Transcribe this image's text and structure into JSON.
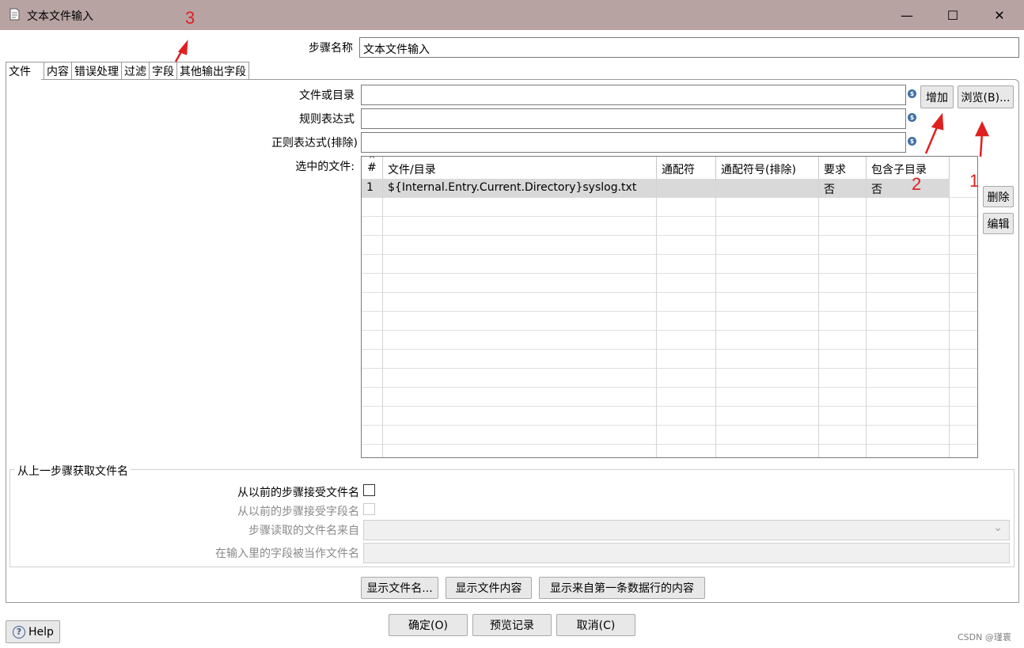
{
  "window": {
    "title": "文本文件输入",
    "controls": {
      "minimize": "—",
      "maximize": "☐",
      "close": "✕"
    }
  },
  "step_name": {
    "label": "步骤名称",
    "value": "文本文件输入"
  },
  "tabs": [
    {
      "label": "文件"
    },
    {
      "label": "内容"
    },
    {
      "label": "错误处理"
    },
    {
      "label": "过滤"
    },
    {
      "label": "字段"
    },
    {
      "label": "其他输出字段"
    }
  ],
  "file_section": {
    "file_or_dir_label": "文件或目录",
    "regex_label": "规则表达式",
    "regex_exclude_label": "正则表达式(排除)",
    "selected_files_label": "选中的文件:",
    "add_button": "增加",
    "browse_button": "浏览(B)...",
    "delete_button": "删除",
    "edit_button": "编辑",
    "variable_icon_glyph": "$"
  },
  "table": {
    "columns": [
      "#",
      "文件/目录",
      "通配符",
      "通配符号(排除)",
      "要求",
      "包含子目录"
    ],
    "sort_glyph": "^",
    "rows": [
      [
        "1",
        "${Internal.Entry.Current.Directory}syslog.txt",
        "",
        "",
        "否",
        "否"
      ]
    ]
  },
  "previous_step": {
    "group_title": "从上一步骤获取文件名",
    "accept_filenames_label": "从以前的步骤接受文件名",
    "accept_field_label": "从以前的步骤接受字段名",
    "read_from_step_label": "步骤读取的文件名来自",
    "field_as_filename_label": "在输入里的字段被当作文件名",
    "dropdown_glyph": "⌄"
  },
  "bottom_buttons": {
    "show_filenames": "显示文件名...",
    "show_file_content": "显示文件内容",
    "show_first_row": "显示来自第一条数据行的内容"
  },
  "footer": {
    "ok": "确定(O)",
    "preview": "预览记录",
    "cancel": "取消(C)",
    "help": "Help",
    "help_glyph": "?",
    "watermark": "CSDN @瑾寰"
  },
  "annotations": {
    "one": "1",
    "two": "2",
    "three": "3"
  },
  "colors": {
    "titlebar": "#b8a3a3",
    "annotation": "#e02020",
    "selected_row": "#d9d9d9"
  }
}
